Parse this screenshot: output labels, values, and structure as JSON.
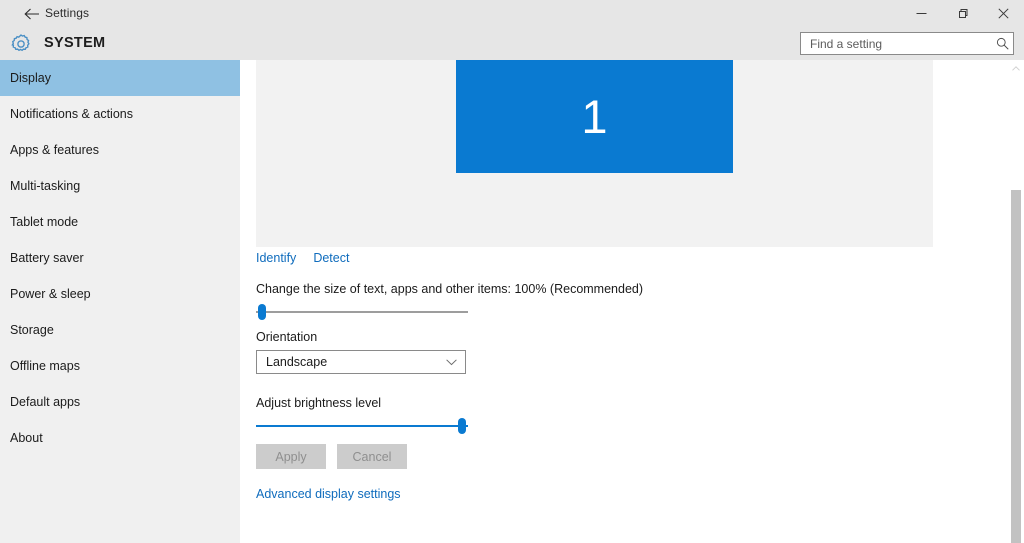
{
  "window": {
    "title": "Settings",
    "back_icon": "back-arrow-icon",
    "controls": {
      "minimize": "minimize-icon",
      "restore": "restore-icon",
      "close": "close-icon"
    }
  },
  "header": {
    "icon": "gear-icon",
    "title": "SYSTEM",
    "search": {
      "placeholder": "Find a setting",
      "value": "",
      "icon": "search-icon"
    }
  },
  "sidebar": {
    "items": [
      {
        "label": "Display",
        "selected": true
      },
      {
        "label": "Notifications & actions",
        "selected": false
      },
      {
        "label": "Apps & features",
        "selected": false
      },
      {
        "label": "Multi-tasking",
        "selected": false
      },
      {
        "label": "Tablet mode",
        "selected": false
      },
      {
        "label": "Battery saver",
        "selected": false
      },
      {
        "label": "Power & sleep",
        "selected": false
      },
      {
        "label": "Storage",
        "selected": false
      },
      {
        "label": "Offline maps",
        "selected": false
      },
      {
        "label": "Default apps",
        "selected": false
      },
      {
        "label": "About",
        "selected": false
      }
    ]
  },
  "main": {
    "display_preview": {
      "monitor_number": "1",
      "monitor_color": "#0a7ad1"
    },
    "identify_link": "Identify",
    "detect_link": "Detect",
    "scaling": {
      "label": "Change the size of text, apps and other items: 100% (Recommended)",
      "value_percent": 100,
      "slider_position_percent": 0
    },
    "orientation": {
      "label": "Orientation",
      "selected": "Landscape",
      "chevron_icon": "chevron-down-icon"
    },
    "brightness": {
      "label": "Adjust brightness level",
      "slider_position_percent": 95
    },
    "buttons": {
      "apply": "Apply",
      "cancel": "Cancel",
      "disabled": true
    },
    "advanced_link": "Advanced display settings"
  },
  "colors": {
    "accent": "#0a7ad1",
    "link": "#0f6cbd",
    "selection": "#8fc1e3",
    "chrome": "#e6e6e6",
    "sidebar": "#f0f0f0",
    "preview_panel": "#f2f2f2"
  },
  "scrollbar": {
    "thumb_color": "#c2c2c2"
  }
}
